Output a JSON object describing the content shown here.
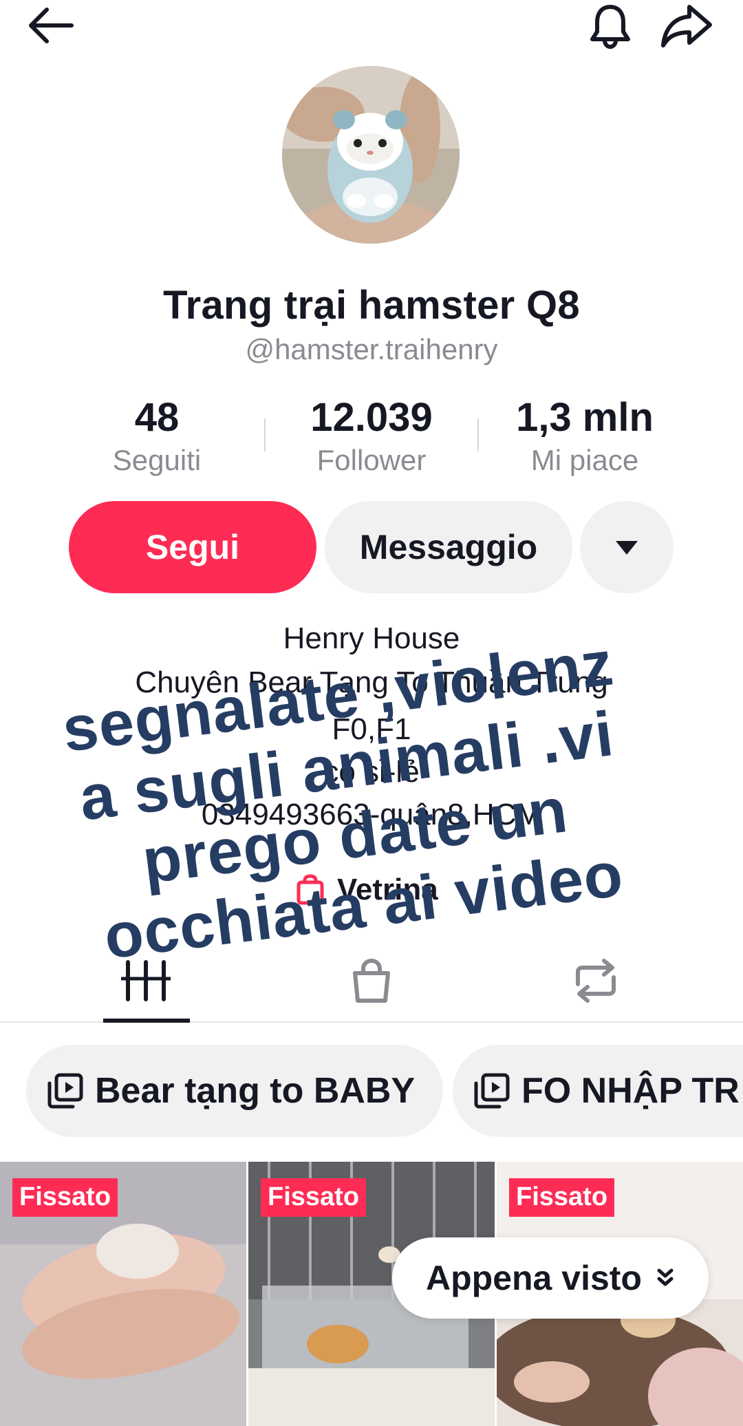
{
  "profile": {
    "name": "Trang trại hamster Q8",
    "handle": "@hamster.traihenry"
  },
  "stats": {
    "following": {
      "value": "48",
      "label": "Seguiti"
    },
    "followers": {
      "value": "12.039",
      "label": "Follower"
    },
    "likes": {
      "value": "1,3 mln",
      "label": "Mi piace"
    }
  },
  "actions": {
    "follow": "Segui",
    "message": "Messaggio"
  },
  "bio": {
    "line1": "Henry House",
    "line2": "Chuyên Bear Tạng To Thuần Trung",
    "line3": "F0,F1",
    "line4": "có sỉ-lẻ",
    "line5": "0349493663-quận8,HCM"
  },
  "storefront": {
    "label": "Vetrina"
  },
  "overlay_caption": {
    "line1": "segnalate ,violenz",
    "line2": "a sugli animali .vi",
    "line3": "prego date un",
    "line4": "occhiata ai video"
  },
  "playlists": [
    {
      "label": "Bear tạng to BABY"
    },
    {
      "label": "FO NHẬP TR"
    }
  ],
  "videos": [
    {
      "badge": "Fissato"
    },
    {
      "badge": "Fissato"
    },
    {
      "badge": "Fissato"
    }
  ],
  "sort_button": {
    "label": "Appena visto"
  },
  "colors": {
    "accent": "#fe2c55",
    "text": "#161823",
    "muted": "#8a8b91",
    "surface": "#f1f1f2",
    "overlay_text": "#263d63"
  },
  "icons": [
    "back-arrow-icon",
    "bell-icon",
    "share-icon",
    "caret-down-icon",
    "shop-bag-icon",
    "videos-grid-icon",
    "repost-icon",
    "playlist-icon",
    "chevron-double-down-icon"
  ]
}
